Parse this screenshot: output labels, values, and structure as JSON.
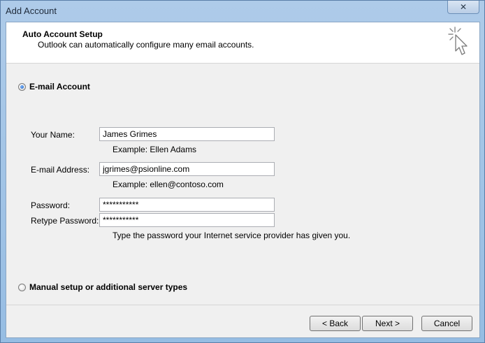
{
  "window": {
    "title": "Add Account",
    "close_symbol": "✕"
  },
  "header": {
    "title": "Auto Account Setup",
    "subtitle": "Outlook can automatically configure many email accounts."
  },
  "options": {
    "email_account_label": "E-mail Account",
    "email_account_selected": true,
    "manual_setup_label": "Manual setup or additional server types",
    "manual_setup_selected": false
  },
  "form": {
    "name_label": "Your Name:",
    "name_value": "James Grimes",
    "name_example": "Example: Ellen Adams",
    "email_label": "E-mail Address:",
    "email_value": "jgrimes@psionline.com",
    "email_example": "Example: ellen@contoso.com",
    "password_label": "Password:",
    "password_value": "***********",
    "retype_label": "Retype Password:",
    "retype_value": "***********",
    "password_hint": "Type the password your Internet service provider has given you."
  },
  "buttons": {
    "back": "< Back",
    "next": "Next >",
    "cancel": "Cancel"
  },
  "icons": {
    "header": "wizard-cursor-icon"
  }
}
